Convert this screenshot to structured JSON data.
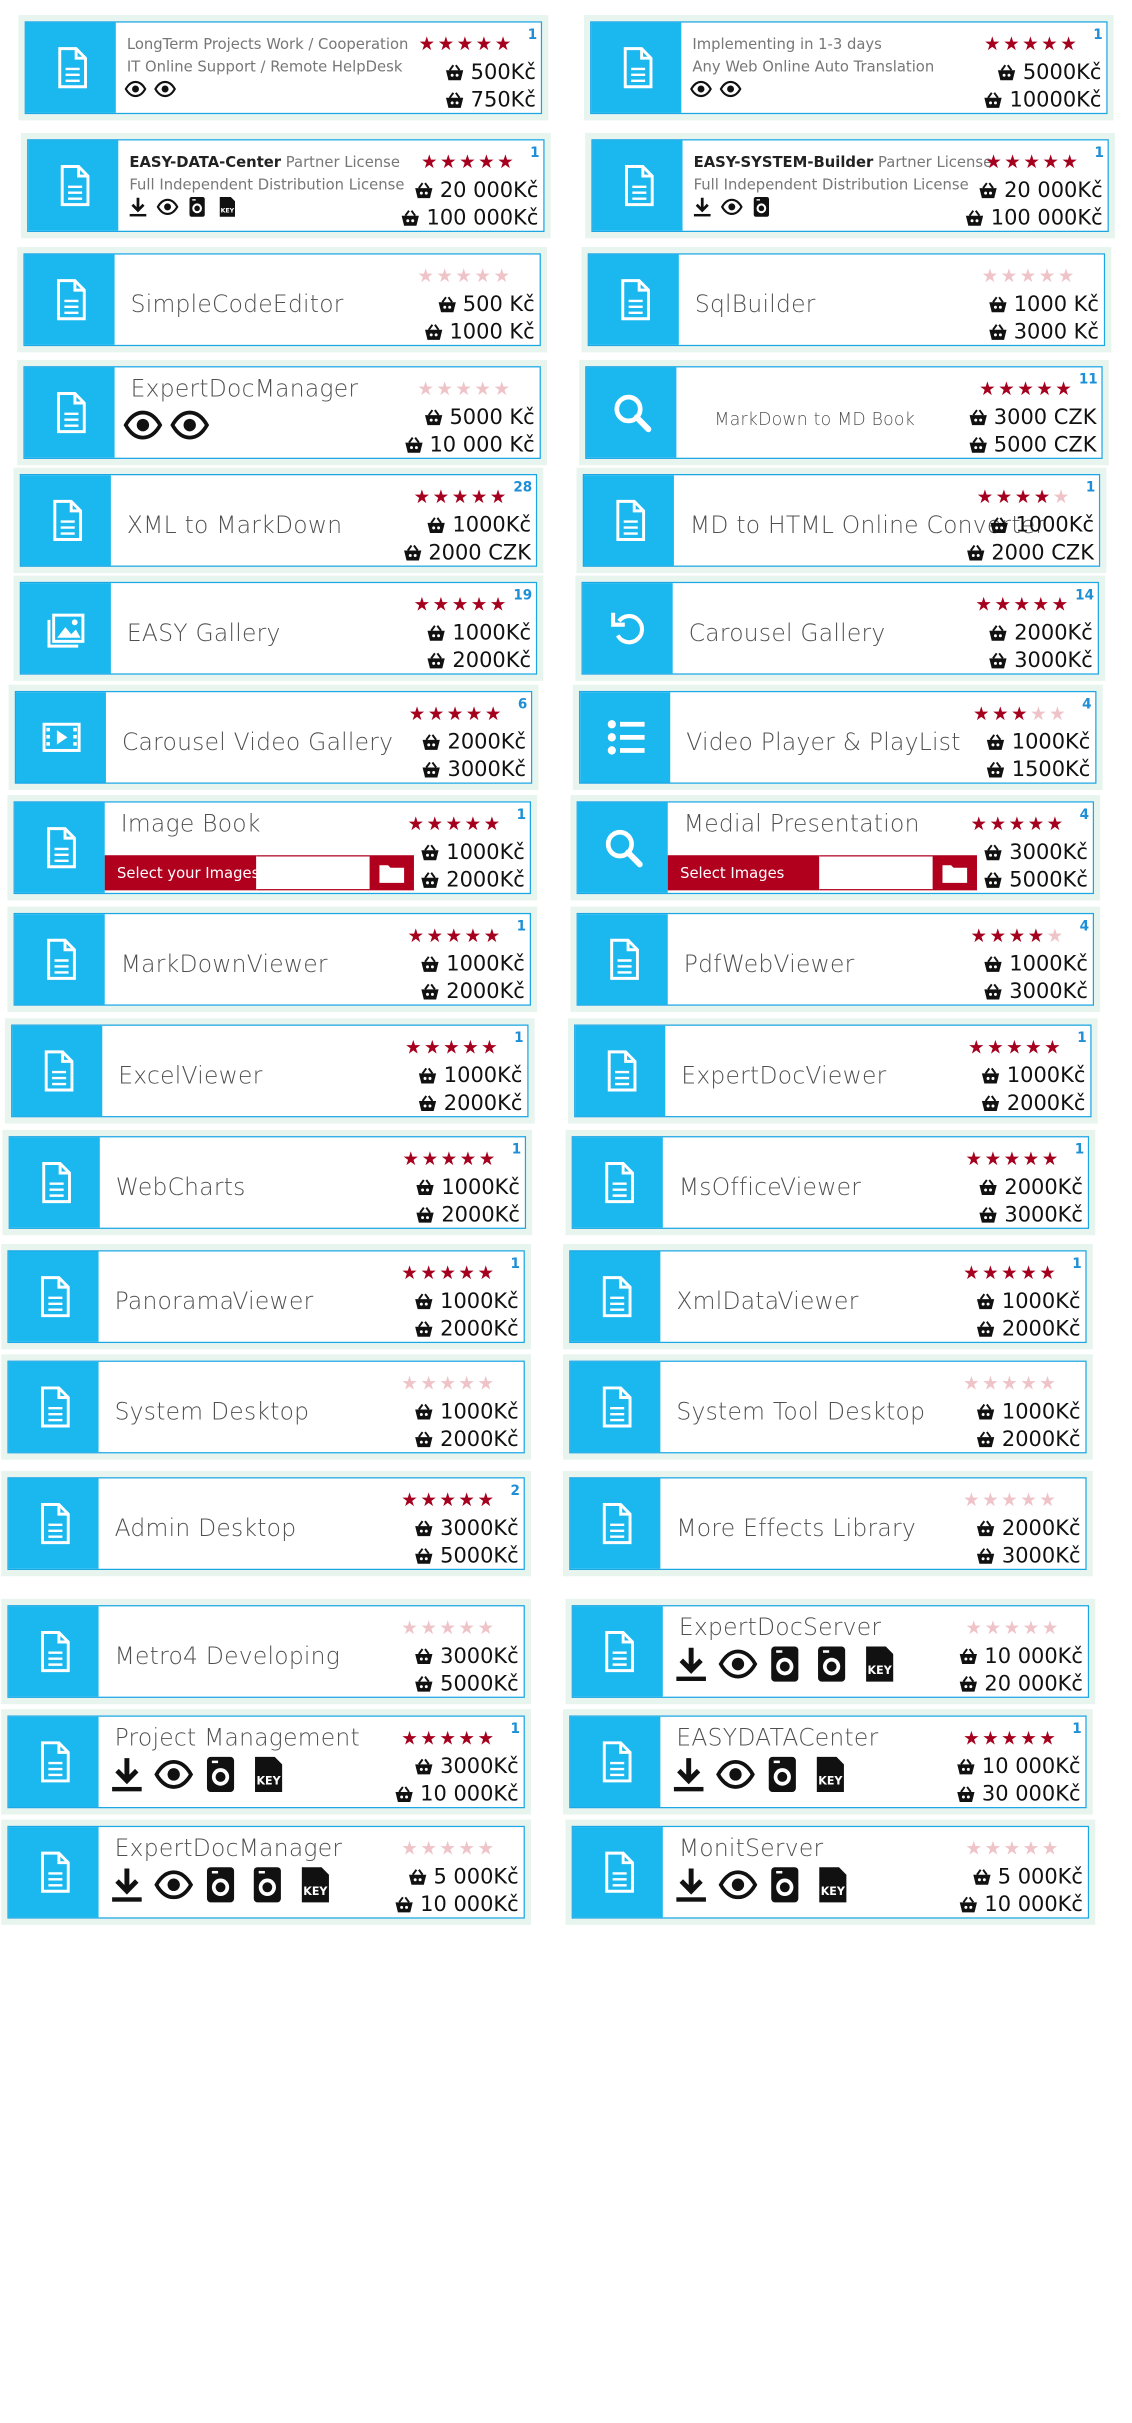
{
  "colors": {
    "tile_icon": "#1ab8ef",
    "tile_border": "#1ba6e4",
    "star_on": "#a5001d",
    "star_off": "#efc4c9",
    "file_accent": "#b0001e"
  },
  "tiles": [
    {
      "title": "",
      "desc1": "LongTerm Projects Work / Cooperation",
      "desc2": "IT Online Support / Remote HelpDesk",
      "rating": 5,
      "count": "1",
      "price1": "500Kč",
      "price2": "750Kč",
      "icon": "document-icon",
      "features": [
        "eye",
        "eye"
      ]
    },
    {
      "title": "",
      "desc1": "Implementing in 1-3 days",
      "desc2": "Any Web Online Auto Translation",
      "rating": 5,
      "count": "1",
      "price1": "5000Kč",
      "price2": "10000Kč",
      "icon": "document-icon",
      "features": [
        "eye",
        "eye"
      ]
    },
    {
      "title": "",
      "desc1_bold": "EASY-DATA-Center",
      "desc1": "Partner License",
      "desc2": "Full Independent Distribution License",
      "rating": 5,
      "count": "1",
      "price1": "20 000Kč",
      "price2": "100 000Kč",
      "icon": "document-icon",
      "features": [
        "download",
        "eye",
        "washer",
        "key"
      ]
    },
    {
      "title": "",
      "desc1_bold": "EASY-SYSTEM-Builder",
      "desc1": "Partner License",
      "desc2": "Full Independent Distribution License",
      "rating": 5,
      "count": "1",
      "price1": "20 000Kč",
      "price2": "100 000Kč",
      "icon": "document-icon",
      "features": [
        "download",
        "eye",
        "washer"
      ]
    },
    {
      "title": "SimpleCodeEditor",
      "rating": 0,
      "count": "",
      "price1": "500 Kč",
      "price2": "1000 Kč",
      "icon": "document-icon"
    },
    {
      "title": "SqlBuilder",
      "rating": 0,
      "count": "",
      "price1": "1000 Kč",
      "price2": "3000 Kč",
      "icon": "document-icon"
    },
    {
      "title": "ExpertDocManager",
      "rating": 0,
      "count": "",
      "price1": "5000 Kč",
      "price2": "10 000 Kč",
      "icon": "document-icon",
      "features": [
        "eye",
        "eye"
      ]
    },
    {
      "title": "MarkDown to MD Book",
      "rating": 5,
      "count": "11",
      "price1": "3000 CZK",
      "price2": "5000 CZK",
      "icon": "search-icon"
    },
    {
      "title": "XML to MarkDown",
      "rating": 5,
      "count": "28",
      "price1": "1000Kč",
      "price2": "2000 CZK",
      "icon": "document-icon"
    },
    {
      "title": "MD to HTML Online Converter",
      "rating": 4,
      "count": "1",
      "price1": "1000Kč",
      "price2": "2000 CZK",
      "icon": "document-icon"
    },
    {
      "title": "EASY Gallery",
      "rating": 5,
      "count": "19",
      "price1": "1000Kč",
      "price2": "2000Kč",
      "icon": "gallery-icon"
    },
    {
      "title": "Carousel Gallery",
      "rating": 5,
      "count": "14",
      "price1": "2000Kč",
      "price2": "3000Kč",
      "icon": "rotate-icon"
    },
    {
      "title": "Carousel Video Gallery",
      "rating": 5,
      "count": "6",
      "price1": "2000Kč",
      "price2": "3000Kč",
      "icon": "film-icon"
    },
    {
      "title": "Video Player & PlayList",
      "rating": 3,
      "count": "4",
      "price1": "1000Kč",
      "price2": "1500Kč",
      "icon": "list-icon"
    },
    {
      "title": "Image Book",
      "rating": 5,
      "count": "1",
      "price1": "1000Kč",
      "price2": "2000Kč",
      "icon": "document-icon",
      "file_label": "Select your Images"
    },
    {
      "title": "Medial Presentation",
      "rating": 5,
      "count": "4",
      "price1": "3000Kč",
      "price2": "5000Kč",
      "icon": "search-icon",
      "file_label": "Select Images"
    },
    {
      "title": "MarkDownViewer",
      "rating": 5,
      "count": "1",
      "price1": "1000Kč",
      "price2": "2000Kč",
      "icon": "document-icon"
    },
    {
      "title": "PdfWebViewer",
      "rating": 4,
      "count": "4",
      "price1": "1000Kč",
      "price2": "3000Kč",
      "icon": "document-icon"
    },
    {
      "title": "ExcelViewer",
      "rating": 5,
      "count": "1",
      "price1": "1000Kč",
      "price2": "2000Kč",
      "icon": "document-icon"
    },
    {
      "title": "ExpertDocViewer",
      "rating": 5,
      "count": "1",
      "price1": "1000Kč",
      "price2": "2000Kč",
      "icon": "document-icon"
    },
    {
      "title": "WebCharts",
      "rating": 5,
      "count": "1",
      "price1": "1000Kč",
      "price2": "2000Kč",
      "icon": "document-icon"
    },
    {
      "title": "MsOfficeViewer",
      "rating": 5,
      "count": "1",
      "price1": "2000Kč",
      "price2": "3000Kč",
      "icon": "document-icon"
    },
    {
      "title": "PanoramaViewer",
      "rating": 5,
      "count": "1",
      "price1": "1000Kč",
      "price2": "2000Kč",
      "icon": "document-icon"
    },
    {
      "title": "XmlDataViewer",
      "rating": 5,
      "count": "1",
      "price1": "1000Kč",
      "price2": "2000Kč",
      "icon": "document-icon"
    },
    {
      "title": "System Desktop",
      "rating": 0,
      "count": "",
      "price1": "1000Kč",
      "price2": "2000Kč",
      "icon": "document-icon"
    },
    {
      "title": "System Tool Desktop",
      "rating": 0,
      "count": "",
      "price1": "1000Kč",
      "price2": "2000Kč",
      "icon": "document-icon"
    },
    {
      "title": "Admin Desktop",
      "rating": 5,
      "count": "2",
      "price1": "3000Kč",
      "price2": "5000Kč",
      "icon": "document-icon"
    },
    {
      "title": "More Effects Library",
      "rating": 0,
      "count": "",
      "price1": "2000Kč",
      "price2": "3000Kč",
      "icon": "document-icon"
    },
    {
      "title": "Metro4 Developing",
      "rating": 0,
      "count": "",
      "price1": "3000Kč",
      "price2": "5000Kč",
      "icon": "document-icon"
    },
    {
      "title": "ExpertDocServer",
      "rating": 0,
      "count": "",
      "price1": "10 000Kč",
      "price2": "20 000Kč",
      "icon": "document-icon",
      "features": [
        "download",
        "eye",
        "washer",
        "washer",
        "key"
      ]
    },
    {
      "title": "Project Management",
      "rating": 5,
      "count": "1",
      "price1": "3000Kč",
      "price2": "10 000Kč",
      "icon": "document-icon",
      "features": [
        "download",
        "eye",
        "washer",
        "key"
      ]
    },
    {
      "title": "EASYDATACenter",
      "rating": 5,
      "count": "1",
      "price1": "10 000Kč",
      "price2": "30 000Kč",
      "icon": "document-icon",
      "features": [
        "download",
        "eye",
        "washer",
        "key"
      ]
    },
    {
      "title": "ExpertDocManager",
      "rating": 0,
      "count": "",
      "price1": "5 000Kč",
      "price2": "10 000Kč",
      "icon": "document-icon",
      "features": [
        "download",
        "eye",
        "washer",
        "washer",
        "key"
      ]
    },
    {
      "title": "MonitServer",
      "rating": 0,
      "count": "",
      "price1": "5 000Kč",
      "price2": "10 000Kč",
      "icon": "document-icon",
      "features": [
        "download",
        "eye",
        "washer",
        "key"
      ]
    }
  ]
}
